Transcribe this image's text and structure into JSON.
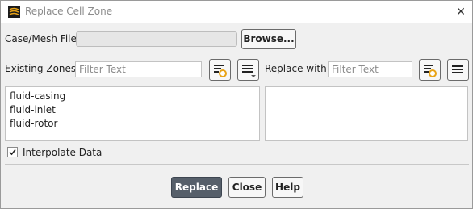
{
  "window": {
    "title": "Replace Cell Zone",
    "close_icon": "close-icon",
    "app_icon": "fluent-app-icon"
  },
  "case_mesh": {
    "label": "Case/Mesh File",
    "value": "",
    "browse_label": "Browse..."
  },
  "existing_zones": {
    "label": "Existing Zones",
    "filter_placeholder": "Filter Text",
    "filter_value": "",
    "items": [
      "fluid-casing",
      "fluid-inlet",
      "fluid-rotor"
    ],
    "icons": [
      "filter-options-icon",
      "list-options-icon"
    ]
  },
  "replace_with": {
    "label": "Replace with",
    "filter_placeholder": "Filter Text",
    "filter_value": "",
    "items": [],
    "icons": [
      "filter-options-icon",
      "list-options-icon"
    ]
  },
  "interpolate": {
    "label": "Interpolate Data",
    "checked": true
  },
  "actions": {
    "replace_label": "Replace",
    "close_label": "Close",
    "help_label": "Help"
  },
  "colors": {
    "primary_button": "#565f6a",
    "window_bg": "#f0f0f0",
    "accent_orange": "#e8a317"
  }
}
